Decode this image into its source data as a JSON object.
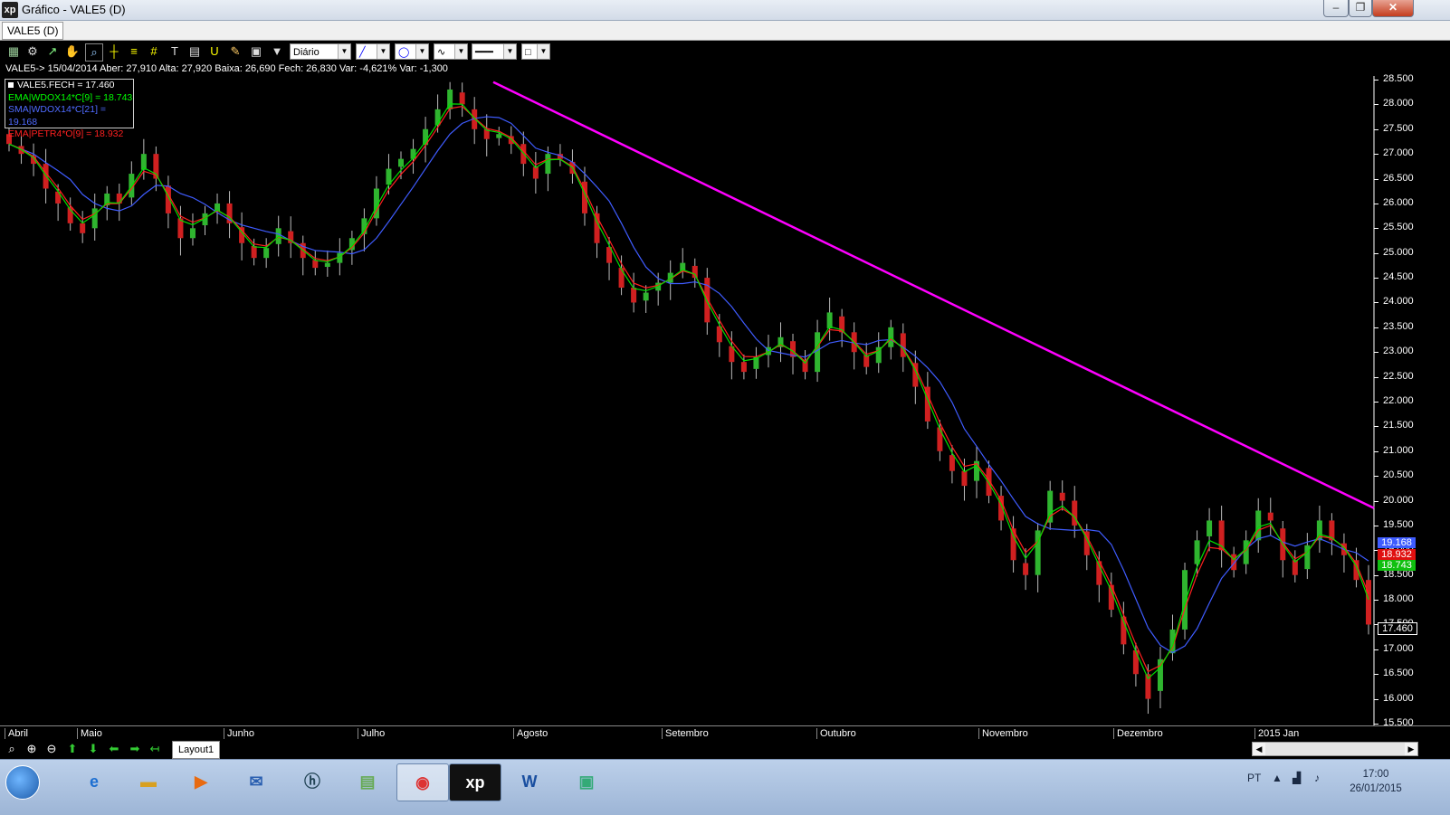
{
  "window": {
    "title": "Gráfico - VALE5 (D)",
    "logo": "xp",
    "buttons": [
      "minimize",
      "maximize",
      "close"
    ]
  },
  "tabs": [
    "VALE5 (D)"
  ],
  "toolbar": {
    "icons": [
      "chart-icon",
      "gear-icon",
      "trend-icon",
      "hand-icon",
      "zoom-data-icon",
      "crosshair-icon",
      "hline-icon",
      "grid-icon",
      "text-tool-icon",
      "calculator-icon",
      "magnet-icon",
      "brush-icon",
      "clipboard-icon",
      "filter-icon"
    ],
    "period": "Diário"
  },
  "info_line": "VALE5-> 15/04/2014 Aber: 27,910 Alta: 27,920 Baixa: 26,690 Fech: 26,830 Var: -4,621% Var: -1,300",
  "legend": [
    {
      "label": "VALE5.FECH = 17.460",
      "color": "#ffffff"
    },
    {
      "label": "EMA|WDOX14*C[9] = 18.743",
      "color": "#00ff00"
    },
    {
      "label": "SMA|WDOX14*C[21] = 19.168",
      "color": "#4f6bff"
    },
    {
      "label": "EMA|PETR4*O[9] = 18.932",
      "color": "#ff2020"
    }
  ],
  "price_axis": [
    "28.500",
    "28.000",
    "27.500",
    "27.000",
    "26.500",
    "26.000",
    "25.500",
    "25.000",
    "24.500",
    "24.000",
    "23.500",
    "23.000",
    "22.500",
    "22.000",
    "21.500",
    "21.000",
    "20.500",
    "20.000",
    "19.500",
    "19.000",
    "18.500",
    "18.000",
    "17.500",
    "17.000",
    "16.500",
    "16.000",
    "15.500"
  ],
  "price_tags": [
    {
      "label": "19.168",
      "color": "#3e5cff"
    },
    {
      "label": "18.932",
      "color": "#e01010"
    },
    {
      "label": "18.743",
      "color": "#10c010"
    },
    {
      "label": "17.460",
      "color": "#000000"
    }
  ],
  "time_axis": [
    "Abril",
    "Maio",
    "Junho",
    "Julho",
    "Agosto",
    "Setembro",
    "Outubro",
    "Novembro",
    "Dezembro",
    "2015 Jan"
  ],
  "bottom_bar": {
    "icons": [
      "zoom-icon",
      "zoom-in-icon",
      "zoom-out-icon",
      "arrow-up-icon",
      "arrow-down-icon",
      "arrow-left-icon",
      "arrow-right-icon",
      "return-icon"
    ],
    "layout_tab": "Layout1"
  },
  "taskbar": {
    "apps": [
      "ie-icon",
      "folder-icon",
      "media-player-icon",
      "outlook-icon",
      "hp-icon",
      "archive-icon",
      "chrome-icon",
      "xp-icon",
      "word-icon",
      "photo-icon"
    ],
    "lang": "PT",
    "time": "17:00",
    "date": "26/01/2015"
  },
  "chart_data": {
    "type": "candlestick",
    "x_range": [
      "Abril",
      "2015 Jan"
    ],
    "ylim": [
      15.5,
      28.6
    ],
    "closes": [
      27.2,
      27.0,
      26.8,
      26.3,
      26.0,
      25.6,
      25.4,
      25.9,
      26.2,
      26.0,
      26.6,
      27.0,
      26.5,
      25.8,
      25.3,
      25.5,
      25.8,
      26.0,
      25.6,
      25.2,
      24.9,
      25.1,
      25.5,
      25.2,
      24.9,
      24.7,
      24.8,
      25.0,
      25.3,
      25.7,
      26.3,
      26.7,
      26.9,
      27.1,
      27.5,
      27.9,
      28.3,
      28.0,
      27.5,
      27.3,
      27.4,
      27.2,
      26.8,
      26.5,
      27.0,
      26.9,
      26.6,
      25.8,
      25.2,
      24.8,
      24.3,
      24.0,
      24.2,
      24.4,
      24.6,
      24.8,
      24.5,
      23.6,
      23.2,
      22.8,
      22.6,
      22.9,
      23.1,
      23.3,
      22.9,
      22.6,
      23.4,
      23.8,
      23.4,
      23.0,
      22.7,
      23.1,
      23.5,
      22.9,
      22.3,
      21.6,
      21.0,
      20.6,
      20.3,
      20.8,
      20.1,
      19.6,
      18.8,
      18.5,
      19.4,
      20.2,
      20.0,
      19.5,
      18.9,
      18.3,
      17.8,
      17.1,
      16.5,
      16.0,
      16.8,
      17.4,
      18.6,
      19.2,
      19.6,
      19.0,
      18.6,
      19.2,
      19.8,
      19.6,
      18.8,
      18.5,
      19.1,
      19.6,
      19.2,
      18.9,
      18.4,
      17.5
    ],
    "ema9_wdox": 18.743,
    "sma21_wdox": 19.168,
    "ema9_petr4": 18.932,
    "trendline": [
      [
        28.45,
        "Agosto start"
      ],
      [
        19.85,
        "2015 Jan end"
      ]
    ]
  }
}
